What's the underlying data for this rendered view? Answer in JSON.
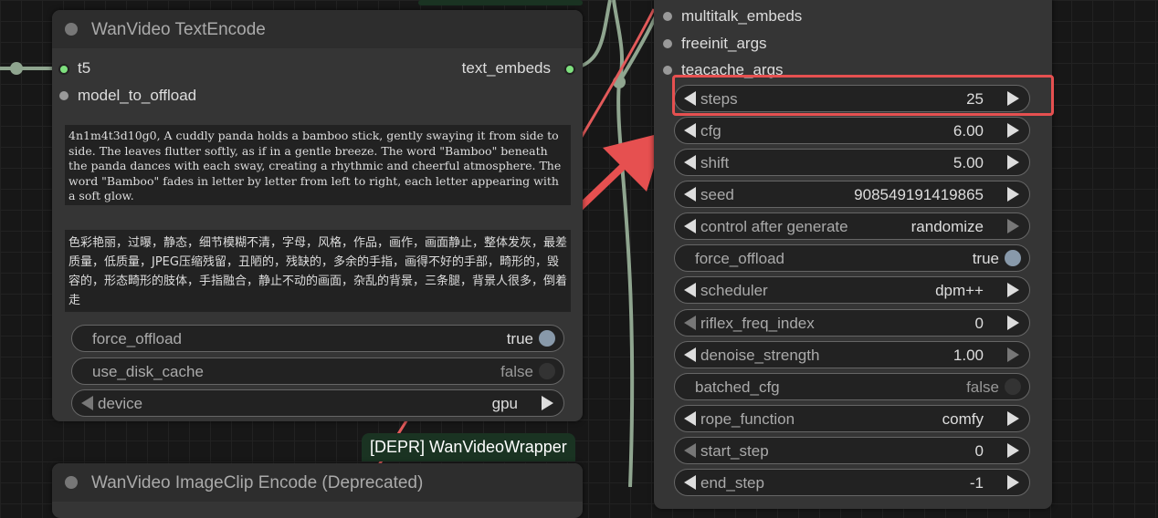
{
  "accent": {
    "wire_green": "#8fa58f",
    "wire_red": "#e35a5a",
    "highlight": "#e65050"
  },
  "top_badge": {
    "label": ""
  },
  "text_encode": {
    "title": "WanVideo TextEncode",
    "inputs": [
      {
        "label": "t5"
      },
      {
        "label": "model_to_offload"
      }
    ],
    "output": {
      "label": "text_embeds"
    },
    "positive_prompt": "4n1m4t3d10g0, A cuddly panda holds a bamboo stick, gently swaying it from side to side. The leaves flutter softly, as if in a gentle breeze. The word \"Bamboo\" beneath the panda dances with each sway, creating a rhythmic and cheerful atmosphere. The word \"Bamboo\" fades in letter by letter from left to right, each letter appearing with a soft glow.",
    "negative_prompt": "色彩艳丽，过曝，静态，细节模糊不清，字母，风格，作品，画作，画面静止，整体发灰，最差质量，低质量，JPEG压缩残留，丑陋的，残缺的，多余的手指，画得不好的手部，畸形的，毁容的，形态畸形的肢体，手指融合，静止不动的画面，杂乱的背景，三条腿，背景人很多，倒着走",
    "widgets": [
      {
        "label": "force_offload",
        "value": "true"
      },
      {
        "label": "use_disk_cache",
        "value": "false"
      },
      {
        "label": "device",
        "value": "gpu"
      }
    ]
  },
  "wrapper_badge": {
    "label": "[DEPR] WanVideoWrapper"
  },
  "image_clip": {
    "title": "WanVideo ImageClip Encode (Deprecated)"
  },
  "sampler": {
    "inputs": [
      {
        "label": "multitalk_embeds"
      },
      {
        "label": "freeinit_args"
      },
      {
        "label": "teacache_args"
      }
    ],
    "widgets": [
      {
        "label": "steps",
        "value": "25"
      },
      {
        "label": "cfg",
        "value": "6.00"
      },
      {
        "label": "shift",
        "value": "5.00"
      },
      {
        "label": "seed",
        "value": "908549191419865"
      },
      {
        "label": "control after generate",
        "value": "randomize"
      },
      {
        "label": "force_offload",
        "value": "true"
      },
      {
        "label": "scheduler",
        "value": "dpm++"
      },
      {
        "label": "riflex_freq_index",
        "value": "0"
      },
      {
        "label": "denoise_strength",
        "value": "1.00"
      },
      {
        "label": "batched_cfg",
        "value": "false"
      },
      {
        "label": "rope_function",
        "value": "comfy"
      },
      {
        "label": "start_step",
        "value": "0"
      },
      {
        "label": "end_step",
        "value": "-1"
      }
    ]
  }
}
